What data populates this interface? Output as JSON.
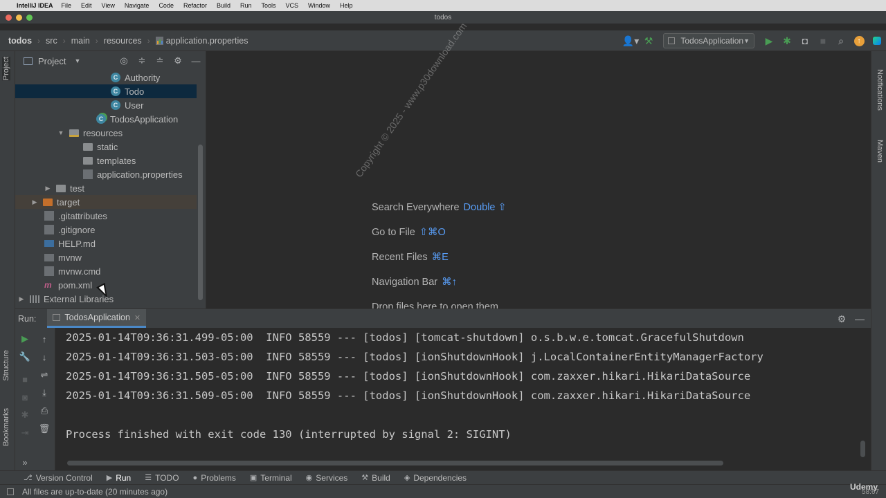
{
  "menubar": {
    "app": "IntelliJ IDEA",
    "items": [
      "File",
      "Edit",
      "View",
      "Navigate",
      "Code",
      "Refactor",
      "Build",
      "Run",
      "Tools",
      "VCS",
      "Window",
      "Help"
    ]
  },
  "window": {
    "title": "todos"
  },
  "breadcrumb": [
    "todos",
    "src",
    "main",
    "resources",
    "application.properties"
  ],
  "toolbar": {
    "run_config": "TodosApplication"
  },
  "left_stripe": {
    "project_tab": "Project",
    "structure_tab": "Structure",
    "bookmarks_tab": "Bookmarks"
  },
  "right_stripe": {
    "notifications_tab": "Notifications",
    "maven_tab": "Maven"
  },
  "project_panel": {
    "title": "Project",
    "tree": [
      {
        "label": "Authority",
        "icon": "class-icon"
      },
      {
        "label": "Todo",
        "icon": "class-icon"
      },
      {
        "label": "User",
        "icon": "class-icon"
      },
      {
        "label": "TodosApplication",
        "icon": "spring-class-icon"
      },
      {
        "label": "resources",
        "icon": "resources-folder-icon"
      },
      {
        "label": "static",
        "icon": "folder-icon"
      },
      {
        "label": "templates",
        "icon": "folder-icon"
      },
      {
        "label": "application.properties",
        "icon": "properties-file-icon"
      },
      {
        "label": "test",
        "icon": "folder-icon"
      },
      {
        "label": "target",
        "icon": "excluded-folder-icon"
      },
      {
        "label": ".gitattributes",
        "icon": "file-icon"
      },
      {
        "label": ".gitignore",
        "icon": "file-icon"
      },
      {
        "label": "HELP.md",
        "icon": "markdown-icon"
      },
      {
        "label": "mvnw",
        "icon": "shell-icon"
      },
      {
        "label": "mvnw.cmd",
        "icon": "file-icon"
      },
      {
        "label": "pom.xml",
        "icon": "maven-icon"
      },
      {
        "label": "External Libraries",
        "icon": "libraries-icon"
      }
    ]
  },
  "editor_hints": [
    {
      "label": "Search Everywhere",
      "key": "Double ⇧"
    },
    {
      "label": "Go to File",
      "key": "⇧⌘O"
    },
    {
      "label": "Recent Files",
      "key": "⌘E"
    },
    {
      "label": "Navigation Bar",
      "key": "⌘↑"
    },
    {
      "label": "Drop files here to open them",
      "key": ""
    }
  ],
  "run_panel": {
    "label": "Run:",
    "tab": "TodosApplication",
    "log_lines": [
      "2025-01-14T09:36:31.499-05:00  INFO 58559 --- [todos] [tomcat-shutdown] o.s.b.w.e.tomcat.GracefulShutdown",
      "2025-01-14T09:36:31.503-05:00  INFO 58559 --- [todos] [ionShutdownHook] j.LocalContainerEntityManagerFactory",
      "2025-01-14T09:36:31.505-05:00  INFO 58559 --- [todos] [ionShutdownHook] com.zaxxer.hikari.HikariDataSource",
      "2025-01-14T09:36:31.509-05:00  INFO 58559 --- [todos] [ionShutdownHook] com.zaxxer.hikari.HikariDataSource"
    ],
    "exit_message": "Process finished with exit code 130 (interrupted by signal 2: SIGINT)"
  },
  "tool_windows": [
    {
      "label": "Version Control",
      "icon": "version-control-icon"
    },
    {
      "label": "Run",
      "icon": "run-icon"
    },
    {
      "label": "TODO",
      "icon": "todo-icon"
    },
    {
      "label": "Problems",
      "icon": "problems-icon"
    },
    {
      "label": "Terminal",
      "icon": "terminal-icon"
    },
    {
      "label": "Services",
      "icon": "services-icon"
    },
    {
      "label": "Build",
      "icon": "build-icon"
    },
    {
      "label": "Dependencies",
      "icon": "dependencies-icon"
    }
  ],
  "status": {
    "message": "All files are up-to-date (20 minutes ago)",
    "udemy": "Udemy",
    "position": "58:67"
  },
  "watermark": "Copyright © 2025 - www.p30download.com",
  "colors": {
    "accent": "#4a88c7",
    "selection": "#0d293e",
    "key_hint": "#589df6",
    "run_green": "#499c54"
  }
}
